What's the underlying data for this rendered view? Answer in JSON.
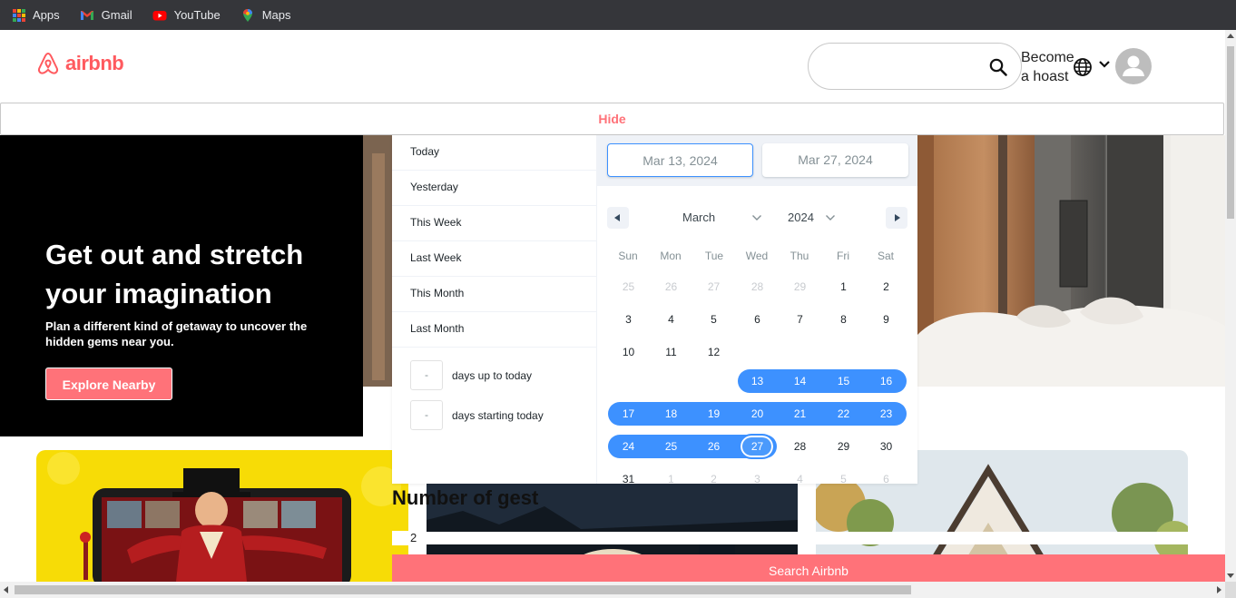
{
  "bookmarks": [
    {
      "label": "Apps",
      "icon": "apps-grid-icon"
    },
    {
      "label": "Gmail",
      "icon": "gmail-icon"
    },
    {
      "label": "YouTube",
      "icon": "youtube-icon"
    },
    {
      "label": "Maps",
      "icon": "maps-icon"
    }
  ],
  "header": {
    "logo_text": "airbnb",
    "become_host": "Become a hoast",
    "brand_color": "#ff5a5f"
  },
  "hide_button": "Hide",
  "hero": {
    "title": "Get out and stretch your imagination",
    "subtitle": "Plan a different kind of getaway to uncover the hidden gems near you.",
    "button": "Explore Nearby"
  },
  "datepicker": {
    "presets": [
      "Today",
      "Yesterday",
      "This Week",
      "Last Week",
      "This Month",
      "Last Month"
    ],
    "range_inputs": [
      {
        "value": "-",
        "label": "days up to today"
      },
      {
        "value": "-",
        "label": "days starting today"
      }
    ],
    "start_date": "Mar 13, 2024",
    "end_date": "Mar 27, 2024",
    "month": "March",
    "year": "2024",
    "weekdays": [
      "Sun",
      "Mon",
      "Tue",
      "Wed",
      "Thu",
      "Fri",
      "Sat"
    ],
    "weeks": [
      [
        "25",
        "26",
        "27",
        "28",
        "29",
        "1",
        "2"
      ],
      [
        "3",
        "4",
        "5",
        "6",
        "7",
        "8",
        "9"
      ],
      [
        "10",
        "11",
        "12",
        "13",
        "14",
        "15",
        "16"
      ],
      [
        "17",
        "18",
        "19",
        "20",
        "21",
        "22",
        "23"
      ],
      [
        "24",
        "25",
        "26",
        "27",
        "28",
        "29",
        "30"
      ],
      [
        "31",
        "1",
        "2",
        "3",
        "4",
        "5",
        "6"
      ]
    ],
    "accent_color": "#3d91ff"
  },
  "guests": {
    "label": "Number of gest",
    "value": "2"
  },
  "search_button": "Search Airbnb"
}
